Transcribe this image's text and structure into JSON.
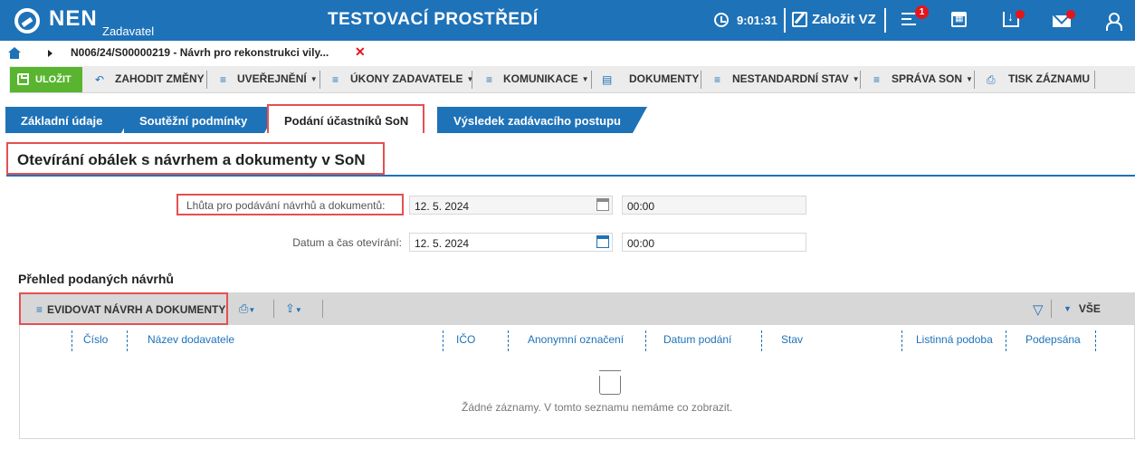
{
  "header": {
    "logo": "NEN",
    "logo_sub": "Zadavatel",
    "environment": "TESTOVACÍ PROSTŘEDÍ",
    "time": "9:01:31",
    "create_label": "Založit VZ",
    "notification_count": "1",
    "icons": [
      "clock-icon",
      "edit-icon",
      "menu-icon",
      "calendar-icon",
      "inbox-icon",
      "mail-icon",
      "user-icon"
    ],
    "accent_color": "#1e72b8",
    "alert_color": "#e4151a"
  },
  "breadcrumb": {
    "text": "N006/24/S00000219 - Návrh pro rekonstrukci vily...",
    "close": "✕"
  },
  "toolbar": {
    "save": "ULOŽIT",
    "discard": "ZAHODIT ZMĚNY",
    "publish": "UVEŘEJNĚNÍ",
    "actions": "ÚKONY ZADAVATELE",
    "communication": "KOMUNIKACE",
    "documents": "DOKUMENTY",
    "nonstandard": "NESTANDARDNÍ STAV",
    "son": "SPRÁVA SON",
    "print": "TISK ZÁZNAMU"
  },
  "tabs": [
    "Základní údaje",
    "Soutěžní podmínky",
    "Podání účastníků SoN",
    "Výsledek zadávacího postupu"
  ],
  "section": {
    "title": "Otevírání obálek s návrhem a dokumenty v SoN",
    "deadline_label": "Lhůta pro podávání návrhů a dokumentů:",
    "deadline_date": "12. 5. 2024",
    "deadline_time": "00:00",
    "opening_label": "Datum a čas otevírání:",
    "opening_date": "12. 5. 2024",
    "opening_time": "00:00"
  },
  "list": {
    "title": "Přehled podaných návrhů",
    "register_button": "EVIDOVAT NÁVRH A DOKUMENTY",
    "all_label": "VŠE",
    "columns": [
      "Číslo",
      "Název dodavatele",
      "IČO",
      "Anonymní označení",
      "Datum podání",
      "Stav",
      "Listinná podoba",
      "Podepsána"
    ],
    "empty_text": "Žádné záznamy. V tomto seznamu nemáme co zobrazit."
  }
}
